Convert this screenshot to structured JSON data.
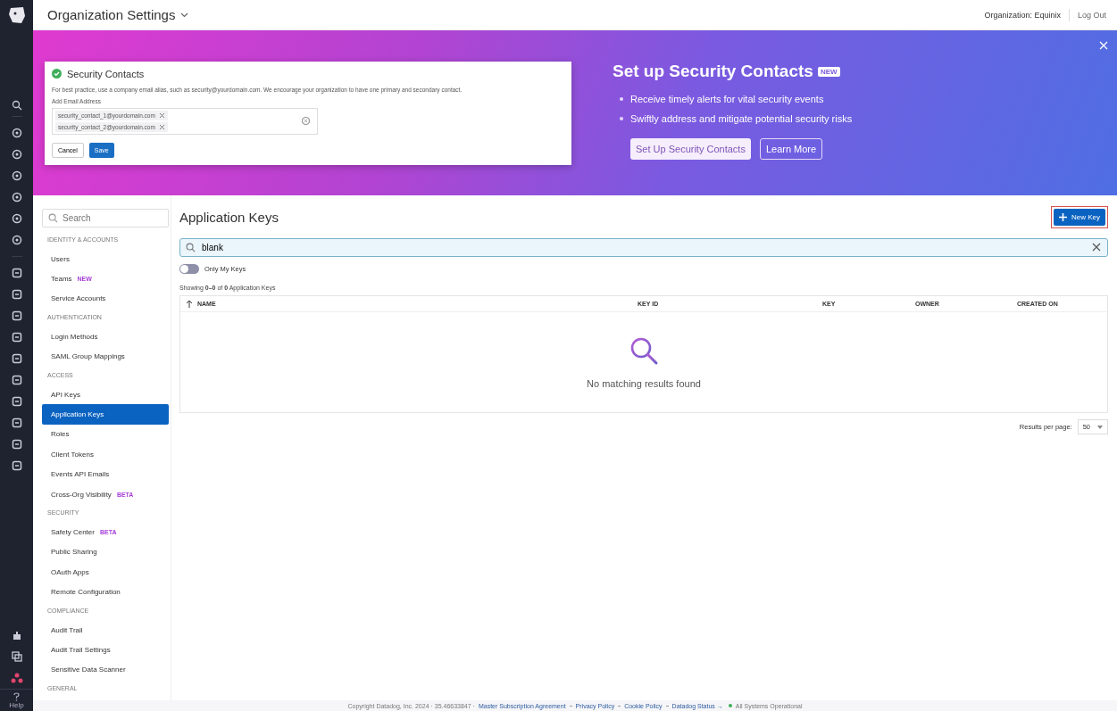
{
  "header": {
    "title": "Organization Settings",
    "organization": "Organization: Equinix",
    "logout": "Log Out"
  },
  "rail": {
    "help": "Help"
  },
  "banner": {
    "card": {
      "title": "Security Contacts",
      "description": "For best practice, use a company email alias, such as security@yourdomain.com. We encourage your organization to have one primary and secondary contact.",
      "field_label": "Add Email Address",
      "emails": [
        "security_contact_1@yourdomain.com",
        "security_contact_2@yourdomain.com"
      ],
      "cancel": "Cancel",
      "save": "Save"
    },
    "title": "Set up Security Contacts",
    "badge": "NEW",
    "bullets": [
      "Receive timely alerts for vital security events",
      "Swiftly address and mitigate potential security risks"
    ],
    "primary_button": "Set Up Security Contacts",
    "secondary_button": "Learn More"
  },
  "sidebar": {
    "search": {
      "placeholder": "Search"
    },
    "items": [
      {
        "kind": "section",
        "label": "IDENTITY & ACCOUNTS"
      },
      {
        "kind": "item",
        "label": "Users",
        "selected": false
      },
      {
        "kind": "item",
        "label": "Teams",
        "selected": false,
        "badge": "NEW"
      },
      {
        "kind": "item",
        "label": "Service Accounts",
        "selected": false
      },
      {
        "kind": "section",
        "label": "AUTHENTICATION"
      },
      {
        "kind": "item",
        "label": "Login Methods",
        "selected": false
      },
      {
        "kind": "item",
        "label": "SAML Group Mappings",
        "selected": false
      },
      {
        "kind": "section",
        "label": "ACCESS"
      },
      {
        "kind": "item",
        "label": "API Keys",
        "selected": false
      },
      {
        "kind": "item",
        "label": "Application Keys",
        "selected": true
      },
      {
        "kind": "item",
        "label": "Roles",
        "selected": false
      },
      {
        "kind": "item",
        "label": "Client Tokens",
        "selected": false
      },
      {
        "kind": "item",
        "label": "Events API Emails",
        "selected": false
      },
      {
        "kind": "item",
        "label": "Cross-Org Visibility",
        "selected": false,
        "badge": "BETA"
      },
      {
        "kind": "section",
        "label": "SECURITY"
      },
      {
        "kind": "item",
        "label": "Safety Center",
        "selected": false,
        "badge": "BETA"
      },
      {
        "kind": "item",
        "label": "Public Sharing",
        "selected": false
      },
      {
        "kind": "item",
        "label": "OAuth Apps",
        "selected": false
      },
      {
        "kind": "item",
        "label": "Remote Configuration",
        "selected": false
      },
      {
        "kind": "section",
        "label": "COMPLIANCE"
      },
      {
        "kind": "item",
        "label": "Audit Trail",
        "selected": false
      },
      {
        "kind": "item",
        "label": "Audit Trail Settings",
        "selected": false
      },
      {
        "kind": "item",
        "label": "Sensitive Data Scanner",
        "selected": false
      },
      {
        "kind": "section",
        "label": "GENERAL"
      }
    ]
  },
  "main": {
    "title": "Application Keys",
    "new_button": "New Key",
    "search": {
      "value": "blank"
    },
    "toggle": {
      "label": "Only My Keys",
      "on": false
    },
    "summary": "Showing **0–0** of **0** Application Keys",
    "table": {
      "columns": [
        "NAME",
        "KEY ID",
        "KEY",
        "OWNER",
        "CREATED ON"
      ],
      "empty": "No matching results found"
    },
    "pagination": {
      "label": "Results per page:",
      "value": "50"
    }
  },
  "footer": {
    "copyright": "Copyright Datadog, Inc. 2024 · 35.46633847 ·",
    "links": [
      "Master Subscription Agreement",
      "Privacy Policy",
      "Cookie Policy",
      "Datadog Status →"
    ],
    "status": "All Systems Operational"
  }
}
